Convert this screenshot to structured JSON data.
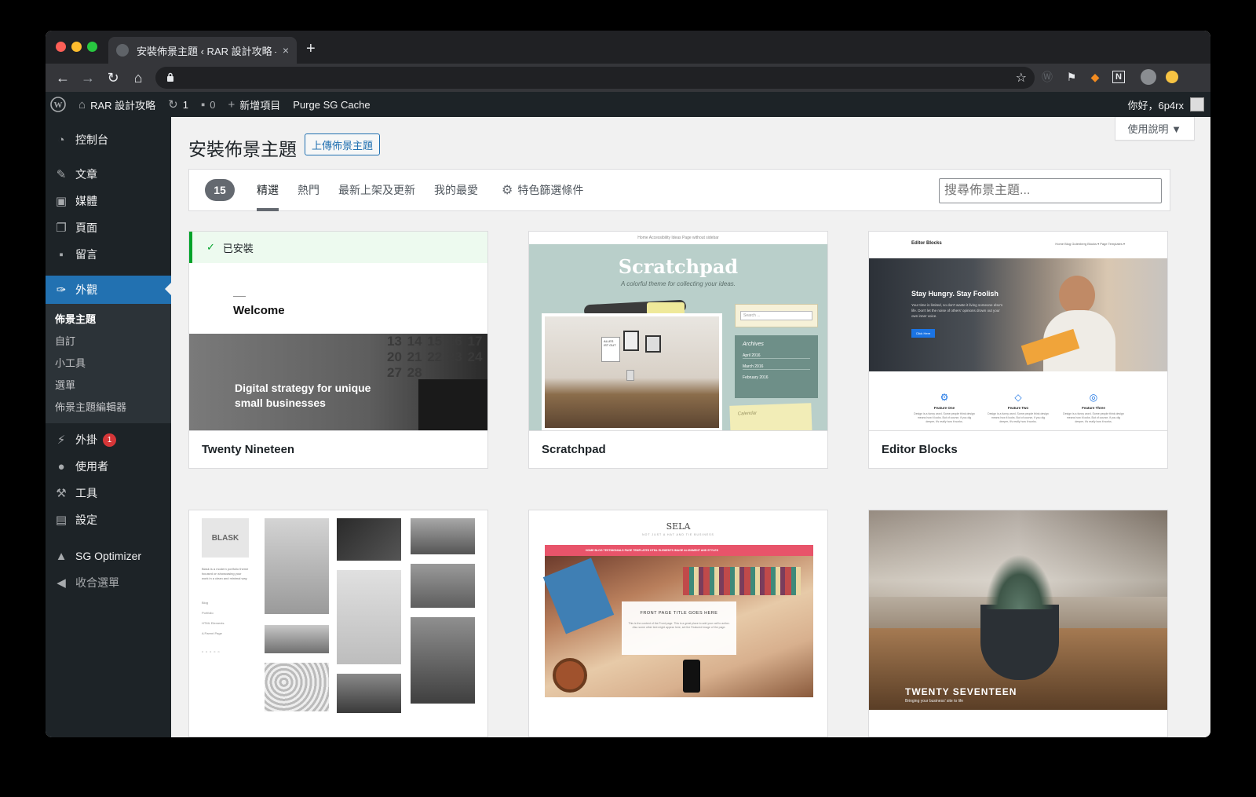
{
  "browser": {
    "tab_title": "安裝佈景主題 ‹ RAR 設計攻略 —",
    "close_label": "×",
    "new_tab_label": "+",
    "url": ""
  },
  "adminbar": {
    "site_name": "RAR 設計攻略",
    "updates_count": "1",
    "comments_count": "0",
    "new_item": "新增項目",
    "purge_cache": "Purge SG Cache",
    "greeting": "你好，6p4rx"
  },
  "sidebar": {
    "dashboard": "控制台",
    "posts": "文章",
    "media": "媒體",
    "pages": "頁面",
    "comments": "留言",
    "appearance": "外觀",
    "appearance_sub": [
      "佈景主題",
      "自訂",
      "小工具",
      "選單",
      "佈景主題編輯器"
    ],
    "plugins": "外掛",
    "plugins_badge": "1",
    "users": "使用者",
    "tools": "工具",
    "settings": "設定",
    "sg_optimizer": "SG Optimizer",
    "collapse": "收合選單"
  },
  "main": {
    "help": "使用說明 ▼",
    "title": "安裝佈景主題",
    "upload_button": "上傳佈景主題",
    "count": "15",
    "filters": [
      "精選",
      "熱門",
      "最新上架及更新",
      "我的最愛"
    ],
    "feature_filter": "特色篩選條件",
    "search_placeholder": "搜尋佈景主題..."
  },
  "themes": {
    "installed_label": "已安裝",
    "t1": {
      "name": "Twenty Nineteen",
      "welcome": "Welcome",
      "hero": "Digital strategy for unique small businesses",
      "calendar_nums": "13 14 15 16 17 20 21 22 23 24 27 28"
    },
    "t2": {
      "name": "Scratchpad",
      "logo": "Scratchpad",
      "tagline": "A colorful theme for collecting your ideas.",
      "nav": "Home    Accessibility    Ideas    Page without sidebar",
      "search": "Search ...",
      "archives": "Archives",
      "archive_items": [
        "April 2016",
        "March 2016",
        "February 2016"
      ],
      "calendar": "Calendar",
      "poster": "ALLES IST GUT"
    },
    "t3": {
      "name": "Editor Blocks",
      "logo": "Editor Blocks",
      "nav": "Home   Blog   Gutenberg   Blocks ▾   Page Templates ▾",
      "headline": "Stay Hungry. Stay Foolish",
      "body": "Your time is limited, so don't waste it living someone else's life. Don't let the noise of others' opinions drown out your own inner voice.",
      "cta": "Click Here",
      "features": [
        "Feature One",
        "Feature Two",
        "Feature Three"
      ],
      "feature_text": "Design is a funny word. Some people think design means how it looks. But of course, if you dig deeper, it's really how it works."
    },
    "t4": {
      "logo": "BLASK",
      "intro": "Blask is a modern portfolio theme focused on showcasing your work in a clean and minimal way.",
      "links": [
        "Blog",
        "Portfolio",
        "HTML Elements",
        "A Parent Page"
      ]
    },
    "t5": {
      "logo": "SELA",
      "tagline": "NOT JUST A HAT AND TIE BUSINESS",
      "nav": "HOME   BLOG   TESTIMONIALS   PAGE TEMPLATES   HTML ELEMENTS   IMAGE ALIGNMENT AND STYLES",
      "panel_title": "FRONT PAGE TITLE GOES HERE",
      "panel_text": "This is the content of the Front page. This is a great place to add your call to action. Also some other text might appear here, set the Featured Image of the page."
    },
    "t6": {
      "title": "TWENTY SEVENTEEN",
      "tagline": "Bringing your business' site to life"
    }
  }
}
